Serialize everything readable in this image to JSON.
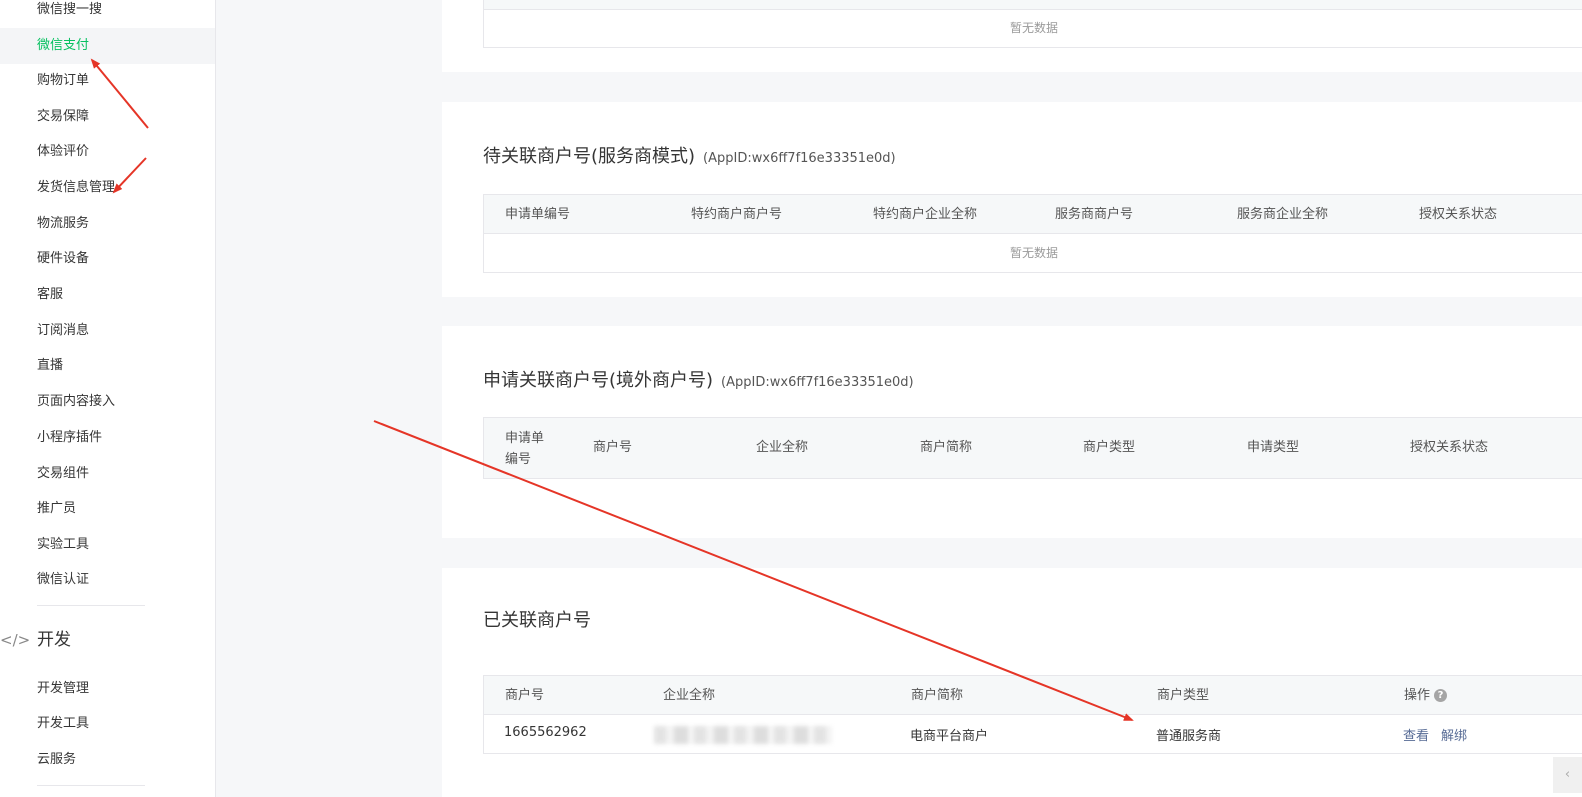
{
  "sidebar": {
    "items": [
      {
        "label": "微信搜一搜"
      },
      {
        "label": "微信支付"
      },
      {
        "label": "购物订单"
      },
      {
        "label": "交易保障"
      },
      {
        "label": "体验评价"
      },
      {
        "label": "发货信息管理"
      },
      {
        "label": "物流服务"
      },
      {
        "label": "硬件设备"
      },
      {
        "label": "客服"
      },
      {
        "label": "订阅消息"
      },
      {
        "label": "直播"
      },
      {
        "label": "页面内容接入"
      },
      {
        "label": "小程序插件"
      },
      {
        "label": "交易组件"
      },
      {
        "label": "推广员"
      },
      {
        "label": "实验工具"
      },
      {
        "label": "微信认证"
      }
    ],
    "dev_group": {
      "icon": "code-icon",
      "icon_glyph": "</>",
      "label": "开发"
    },
    "dev_items": [
      {
        "label": "开发管理"
      },
      {
        "label": "开发工具"
      },
      {
        "label": "云服务"
      }
    ]
  },
  "top_card": {
    "empty_text": "暂无数据"
  },
  "pending_service": {
    "title": "待关联商户号(服务商模式)",
    "appid": "(AppID:wx6ff7f16e33351e0d)",
    "columns": [
      "申请单编号",
      "特约商户商户号",
      "特约商户企业全称",
      "服务商商户号",
      "服务商企业全称",
      "授权关系状态"
    ],
    "empty_text": "暂无数据"
  },
  "overseas": {
    "title": "申请关联商户号(境外商户号)",
    "appid": "(AppID:wx6ff7f16e33351e0d)",
    "columns": [
      "申请单\n编号",
      "商户号",
      "企业全称",
      "商户简称",
      "商户类型",
      "申请类型",
      "授权关系状态"
    ]
  },
  "linked": {
    "title": "已关联商户号",
    "columns": [
      "商户号",
      "企业全称",
      "商户简称",
      "商户类型",
      "操作"
    ],
    "help_icon": "question-icon",
    "rows": [
      {
        "merchant_id": "1665562962",
        "short_name": "电商平台商户",
        "type": "普通服务商",
        "action_view": "查看",
        "action_unbind": "解绑"
      }
    ]
  },
  "colors": {
    "active": "#07c160",
    "link": "#576b95",
    "arrow": "#e53527"
  },
  "collapse_icon": "chevron-left-icon"
}
